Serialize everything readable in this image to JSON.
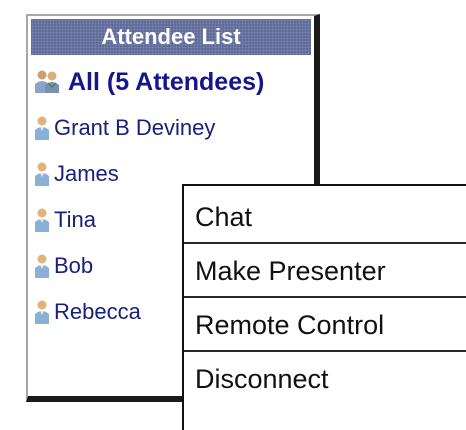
{
  "attendee_panel": {
    "title": "Attendee List",
    "all_label": "All (5 Attendees)",
    "attendees": [
      "Grant B Deviney",
      "James",
      "Tina",
      "Bob",
      "Rebecca"
    ]
  },
  "context_menu": {
    "items": [
      "Chat",
      "Make Presenter",
      "Remote Control",
      "Disconnect"
    ]
  },
  "icons": {
    "group": "group-users-icon",
    "person": "person-icon"
  },
  "colors": {
    "header_bg": "#5a6596",
    "name_text": "#18207a",
    "all_text": "#16168c"
  }
}
